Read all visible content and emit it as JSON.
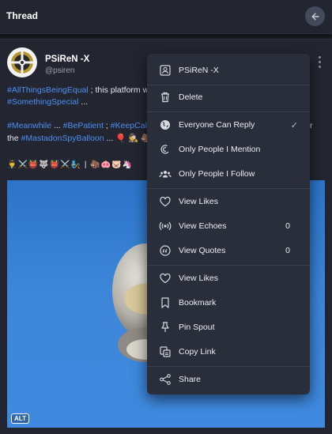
{
  "header": {
    "title": "Thread",
    "back_icon": "arrow-left-icon"
  },
  "post": {
    "author_name": "PSiReN -X",
    "author_handle": "@psiren",
    "line1_tag": "#AllThingsBeingEqual",
    "line1_text": " ; this platform w",
    "line2_tag": "#SomethingSpecial",
    "line2_text": " ...",
    "line3_tag1": "#Meanwhile",
    "line3_sep1": " ... ",
    "line3_tag2": "#BePatient",
    "line3_sep2": " ; ",
    "line3_tag3": "#KeepCalm",
    "line3_right": "r",
    "line4_prefix": "the ",
    "line4_tag": "#MastadonSpyBalloon",
    "line4_text": " ... 🎈 🕵️ 🦣",
    "emoji_row": "👨‍✈️⚔️👹🐺👹⚔️🧞 | 🦣🐽🐷🦄",
    "alt_badge": "ALT"
  },
  "menu": {
    "items": [
      {
        "label": "PSiReN -X",
        "icon": "user-card-icon"
      },
      {
        "label": "Delete",
        "icon": "trash-icon"
      },
      {
        "label": "Everyone Can Reply",
        "icon": "globe-icon",
        "selected": "✓"
      },
      {
        "label": "Only People I Mention",
        "icon": "mention-icon"
      },
      {
        "label": "Only People I Follow",
        "icon": "people-icon"
      },
      {
        "label": "View Likes",
        "icon": "heart-icon"
      },
      {
        "label": "View Echoes",
        "icon": "echo-icon",
        "count": "0"
      },
      {
        "label": "View Quotes",
        "icon": "quote-icon",
        "count": "0"
      },
      {
        "label": "View Likes",
        "icon": "heart-icon"
      },
      {
        "label": "Bookmark",
        "icon": "bookmark-icon"
      },
      {
        "label": "Pin Spout",
        "icon": "pin-icon"
      },
      {
        "label": "Copy Link",
        "icon": "copy-icon"
      },
      {
        "label": "Share",
        "icon": "share-icon"
      }
    ]
  }
}
